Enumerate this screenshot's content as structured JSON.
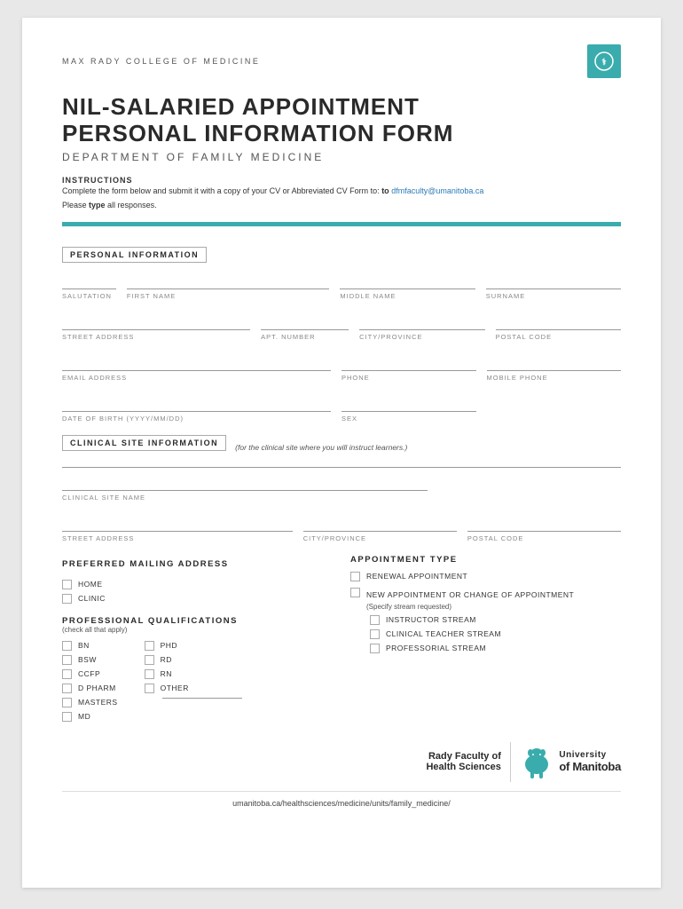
{
  "header": {
    "college": "MAX RADY COLLEGE OF MEDICINE"
  },
  "title": {
    "line1": "NIL-SALARIED APPOINTMENT",
    "line2": "PERSONAL INFORMATION FORM",
    "subtitle": "DEPARTMENT OF FAMILY MEDICINE"
  },
  "instructions": {
    "label": "INSTRUCTIONS",
    "text_prefix": "Complete the form below  and submit it with a copy of your CV or Abbreviated CV Form to:",
    "text_bold": "to",
    "email": "dfmfaculty@umanitoba.ca",
    "note_prefix": "Please ",
    "note_bold": "type",
    "note_suffix": " all responses."
  },
  "personal_info": {
    "heading": "PERSONAL INFORMATION",
    "fields": {
      "salutation": "SALUTATION",
      "first_name": "FIRST NAME",
      "middle_name": "MIDDLE NAME",
      "surname": "SURNAME",
      "street_address": "STREET ADDRESS",
      "apt_number": "APT. NUMBER",
      "city_province": "CITY/PROVINCE",
      "postal_code": "POSTAL CODE",
      "email_address": "EMAIL ADDRESS",
      "phone": "PHONE",
      "mobile_phone": "MOBILE PHONE",
      "date_of_birth": "DATE OF BIRTH (YYYY/MM/DD)",
      "sex": "SEX"
    }
  },
  "clinical_site": {
    "heading": "CLINICAL SITE INFORMATION",
    "note": "(for the clinical site where you will instruct learners.)",
    "fields": {
      "site_name": "CLINICAL SITE NAME",
      "street_address": "STREET ADDRESS",
      "city_province": "CITY/PROVINCE",
      "postal_code": "POSTAL CODE"
    }
  },
  "preferred_mailing": {
    "heading": "PREFERRED MAILING ADDRESS",
    "options": [
      "HOME",
      "CLINIC"
    ]
  },
  "appointment_type": {
    "heading": "APPOINTMENT TYPE",
    "options": [
      {
        "label": "RENEWAL APPOINTMENT"
      },
      {
        "label": "NEW APPOINTMENT OR CHANGE OF APPOINTMENT",
        "sub_note": "(Specify stream requested)",
        "streams": [
          "INSTRUCTOR STREAM",
          "CLINICAL TEACHER STREAM",
          "PROFESSORIAL STREAM"
        ]
      }
    ]
  },
  "professional_qualifications": {
    "heading": "PROFESSIONAL QUALIFICATIONS",
    "sub": "(check all that apply)",
    "col1": [
      "BN",
      "BSW",
      "CCFP",
      "D PHARM",
      "MASTERS",
      "MD"
    ],
    "col2": [
      "PHD",
      "RD",
      "RN",
      "OTHER"
    ]
  },
  "footer": {
    "rady_line1": "Rady Faculty of",
    "rady_line2": "Health Sciences",
    "u_line1": "University",
    "u_line2": "of Manitoba",
    "url": "umanitoba.ca/healthsciences/medicine/units/family_medicine/"
  }
}
